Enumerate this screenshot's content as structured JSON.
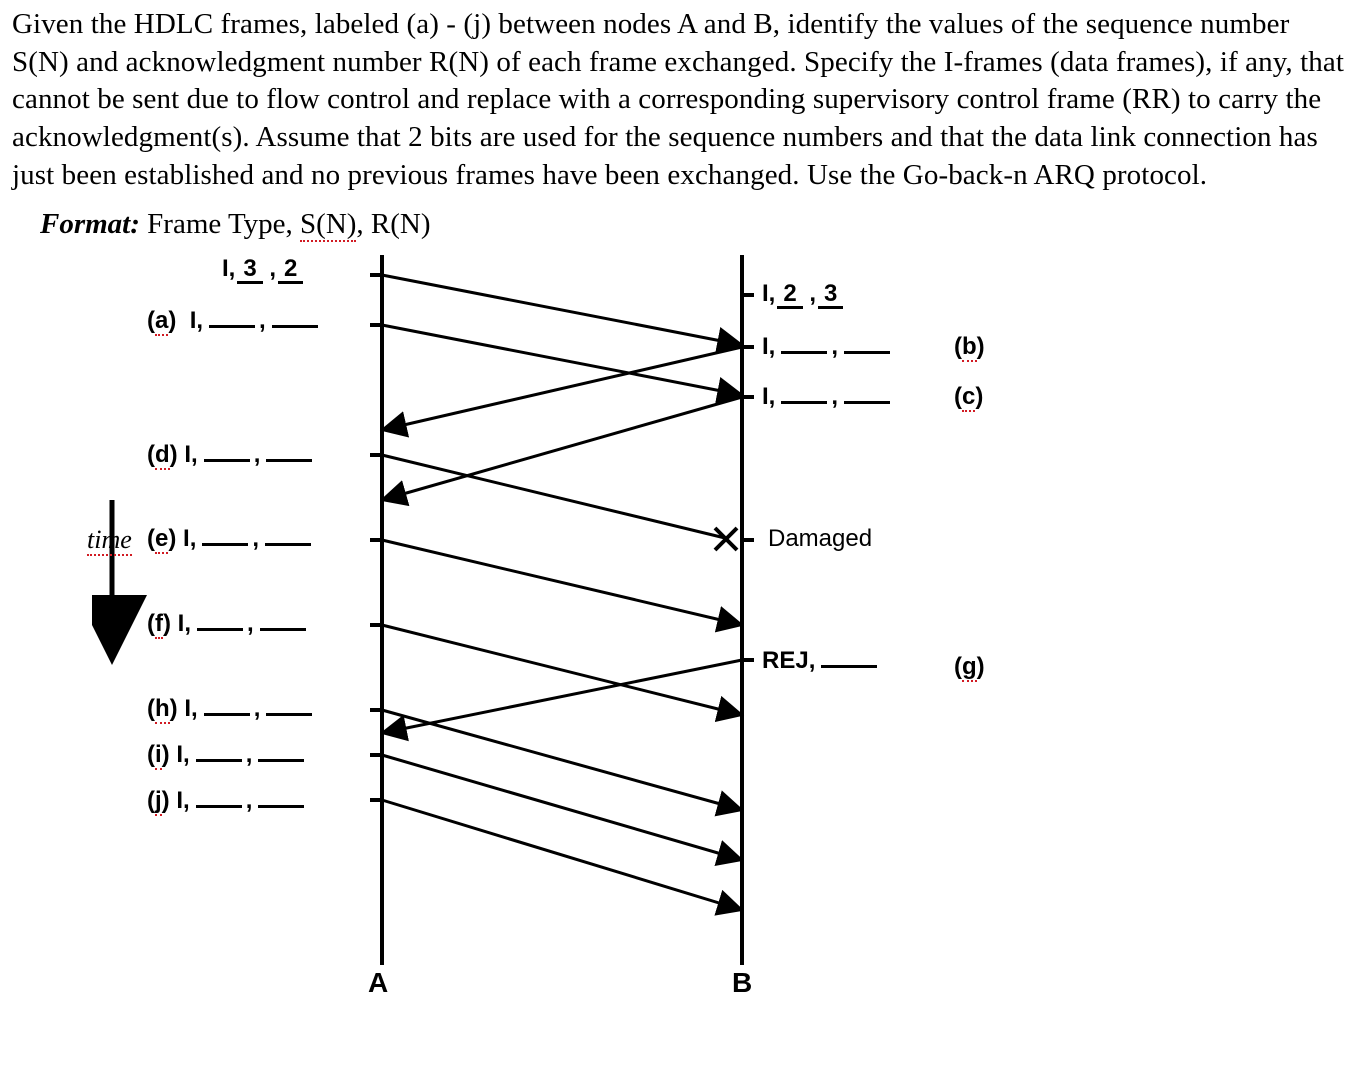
{
  "question": "Given the HDLC frames, labeled (a) - (j) between nodes A and B, identify the values of the sequence number S(N) and acknowledgment number R(N) of each frame exchanged. Specify the I-frames (data frames), if any, that cannot be sent due to flow control and replace with a corresponding supervisory control frame (RR) to carry the acknowledgment(s). Assume that 2 bits are used for the sequence numbers and that the data link connection has just been established and no previous frames have been exchanged. Use the Go-back-n ARQ protocol.",
  "format": {
    "label": "Format:",
    "text_prefix": "Frame Type, ",
    "sn": "S(N)",
    "rn": ", R(N)"
  },
  "example_left": {
    "type": "I",
    "sn": "3",
    "rn": "2"
  },
  "example_right": {
    "type": "I",
    "sn": "2",
    "rn": "3"
  },
  "frames": {
    "a": {
      "side": "A",
      "type": "I"
    },
    "b": {
      "side": "B",
      "type": "I"
    },
    "c": {
      "side": "B",
      "type": "I"
    },
    "d": {
      "side": "A",
      "type": "I"
    },
    "e": {
      "side": "A",
      "type": "I"
    },
    "f": {
      "side": "A",
      "type": "I"
    },
    "g": {
      "side": "B",
      "type": "REJ"
    },
    "h": {
      "side": "A",
      "type": "I"
    },
    "i": {
      "side": "A",
      "type": "I"
    },
    "j": {
      "side": "A",
      "type": "I"
    }
  },
  "damaged_label": "Damaged",
  "time_label": "time",
  "nodes": {
    "A": "A",
    "B": "B"
  }
}
